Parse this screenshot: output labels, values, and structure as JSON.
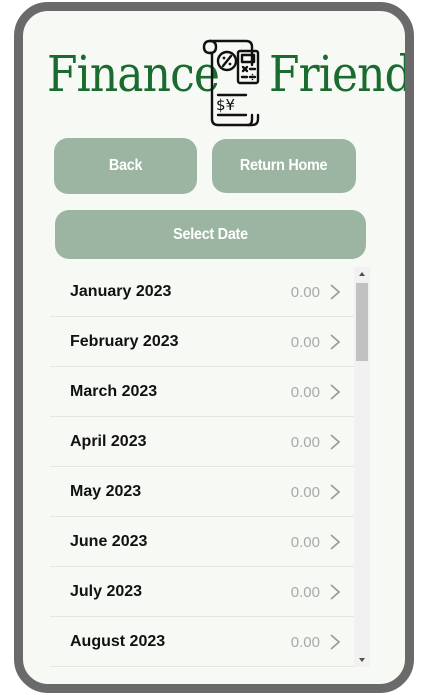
{
  "app": {
    "logo_left": "Finance",
    "logo_right": "Friend",
    "logo_icon": "finance-document-calculator-icon"
  },
  "buttons": {
    "back": "Back",
    "return_home": "Return Home",
    "select_date": "Select Date"
  },
  "months": [
    {
      "label": "January 2023",
      "value": "0.00"
    },
    {
      "label": "February 2023",
      "value": "0.00"
    },
    {
      "label": "March 2023",
      "value": "0.00"
    },
    {
      "label": "April 2023",
      "value": "0.00"
    },
    {
      "label": "May 2023",
      "value": "0.00"
    },
    {
      "label": "June 2023",
      "value": "0.00"
    },
    {
      "label": "July 2023",
      "value": "0.00"
    },
    {
      "label": "August 2023",
      "value": "0.00"
    }
  ],
  "colors": {
    "brand_green": "#1a6b30",
    "button_bg": "#9bb5a2",
    "frame": "#6a6a6a",
    "background": "#f7f9f4"
  }
}
